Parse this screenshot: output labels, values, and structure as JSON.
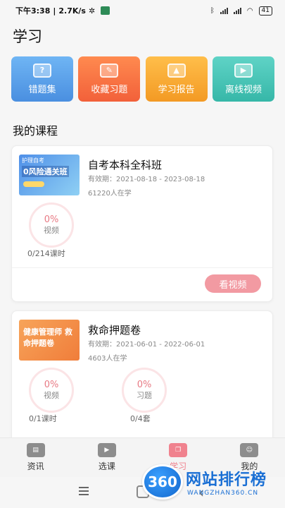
{
  "status_bar": {
    "time": "下午3:38",
    "speed": "2.7K/s",
    "battery": "41"
  },
  "page_title": "学习",
  "quick_actions": [
    {
      "label": "错题集",
      "icon": "question-book-icon",
      "color": "#5aa2ee"
    },
    {
      "label": "收藏习题",
      "icon": "edit-note-icon",
      "color": "#f4733f"
    },
    {
      "label": "学习报告",
      "icon": "report-stamp-icon",
      "color": "#f7a92e"
    },
    {
      "label": "离线视频",
      "icon": "play-video-icon",
      "color": "#45c4b5"
    }
  ],
  "section_title": "我的课程",
  "courses": [
    {
      "thumb_text_top": "护理自考",
      "thumb_text_main": "0风险通关班",
      "name": "自考本科全科班",
      "valid": "有效期：2021-08-18 - 2023-08-18",
      "learners": "61220人在学",
      "progress": [
        {
          "pct": "0%",
          "kind": "视频",
          "sub": "0/214课时"
        }
      ],
      "button": "看视频"
    },
    {
      "thumb_text_main": "健康管理师 救命押题卷",
      "name": "救命押题卷",
      "valid": "有效期：2021-06-01 - 2022-06-01",
      "learners": "4603人在学",
      "progress": [
        {
          "pct": "0%",
          "kind": "视频",
          "sub": "0/1课时"
        },
        {
          "pct": "0%",
          "kind": "习题",
          "sub": "0/4套"
        }
      ]
    }
  ],
  "tabs": [
    {
      "label": "资讯",
      "icon": "news-icon"
    },
    {
      "label": "选课",
      "icon": "tv-icon"
    },
    {
      "label": "学习",
      "icon": "open-book-icon",
      "active": true
    },
    {
      "label": "我的",
      "icon": "user-icon"
    }
  ],
  "watermark": {
    "badge": "360",
    "name": "网站排行榜",
    "url": "WANGZHAN360.CN"
  },
  "colors": {
    "accent": "#f0828e",
    "button": "#f29aa2"
  }
}
